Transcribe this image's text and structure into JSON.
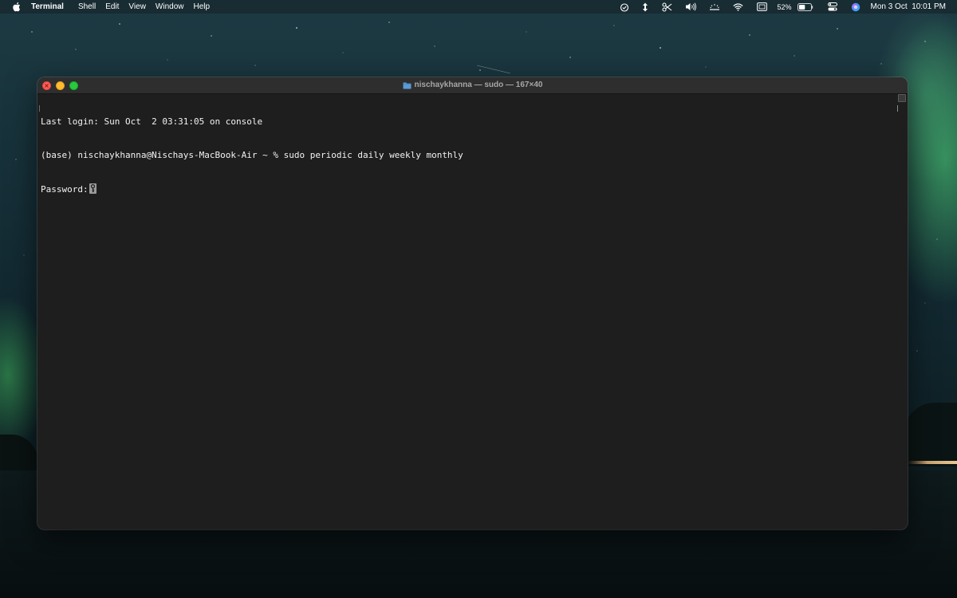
{
  "menubar": {
    "apple_icon": "apple-logo-icon",
    "app_name": "Terminal",
    "menus": [
      "Shell",
      "Edit",
      "View",
      "Window",
      "Help"
    ],
    "status_icons": [
      "focus-icon",
      "transfer-icon",
      "scissors-icon",
      "volume-icon",
      "keyboard-brightness-icon",
      "wifi-icon",
      "screen-mirroring-icon"
    ],
    "battery_percent": "52%",
    "battery_level": 0.52,
    "clock_date": "Mon 3 Oct",
    "clock_time": "10:01 PM"
  },
  "window": {
    "title": "nischaykhanna — sudo — 167×40",
    "title_icon": "folder-icon",
    "traffic_lights": [
      "close",
      "minimize",
      "zoom"
    ],
    "colors": {
      "close": "#fe5f57",
      "minimize": "#febc2e",
      "zoom": "#28c840",
      "background": "#1e1e1e",
      "text": "#f2f2f2"
    }
  },
  "terminal": {
    "lines": [
      "Last login: Sun Oct  2 03:31:05 on console",
      "(base) nischaykhanna@Nischays-MacBook-Air ~ % sudo periodic daily weekly monthly"
    ],
    "password_prompt": "Password:",
    "cursor_icon": "key-cursor-icon"
  }
}
